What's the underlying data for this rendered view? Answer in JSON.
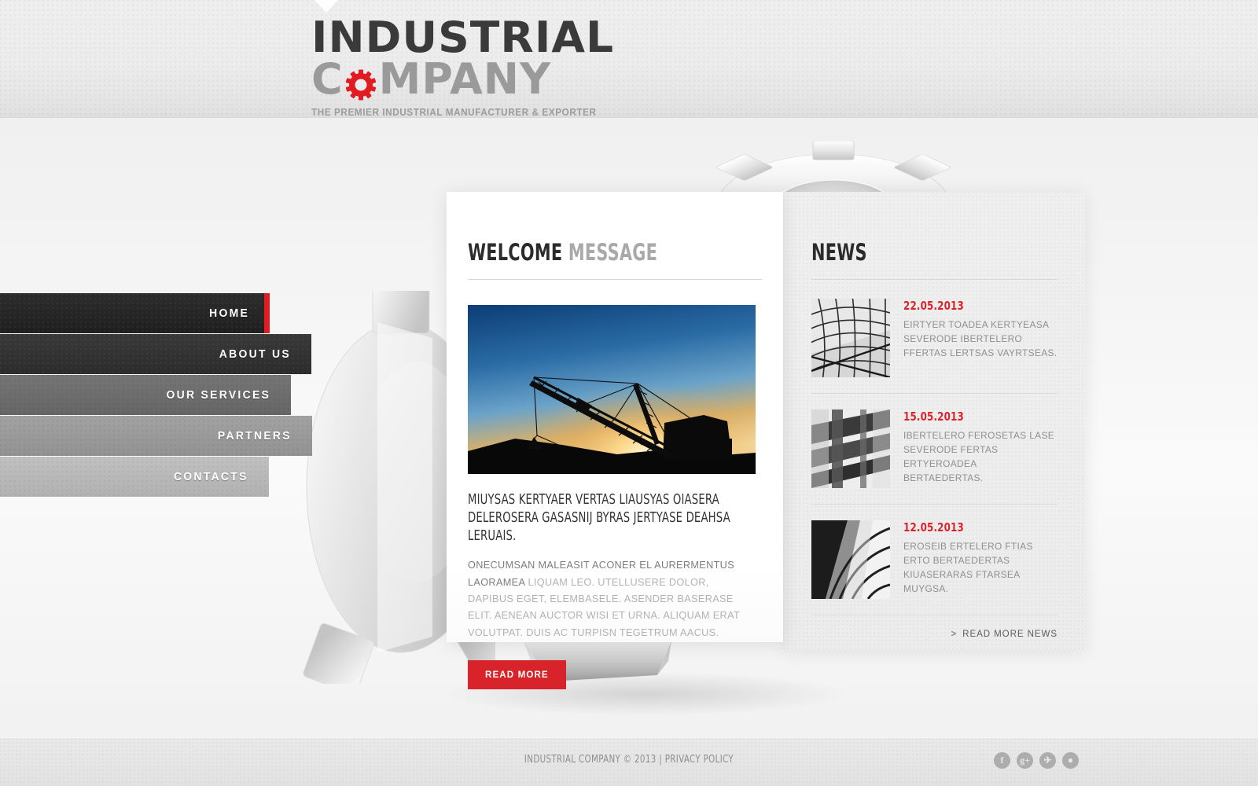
{
  "header": {
    "logo_line1": "INDUSTRIAL",
    "logo_line2_pre": "C",
    "logo_line2_post": "MPANY",
    "logo_gear_icon": "gear-icon",
    "tagline": "THE PREMIER INDUSTRIAL MANUFACTURER & EXPORTER"
  },
  "nav": {
    "items": [
      {
        "label": "HOME",
        "active": true
      },
      {
        "label": "ABOUT US",
        "active": false
      },
      {
        "label": "OUR SERVICES",
        "active": false
      },
      {
        "label": "PARTNERS",
        "active": false
      },
      {
        "label": "CONTACTS",
        "active": false
      }
    ]
  },
  "welcome": {
    "title_dark": "WELCOME",
    "title_light": "MESSAGE",
    "image_alt": "dragline-excavator-at-sunset",
    "lead": "MIUYSAS KERTYAER VERTAS LIAUSYAS OIASERA DELEROSERA GASASNIJ BYRAS JERTYASE DEAHSA LERUAIS.",
    "paragraph_first": "ONECUMSAN MALEASIT ACONER EL AURERMENTUS LAORAMEA",
    "paragraph_rest": " LIQUAM LEO. UTELLUSERE DOLOR, DAPIBUS EGET, ELEMBASELE. ASENDER BASERASE ELIT. AENEAN AUCTOR WISI ET URNA. ALIQUAM ERAT VOLUTPAT. DUIS AC TURPISN TEGETRUM AACUS.",
    "read_more_label": "READ MORE"
  },
  "news": {
    "title": "NEWS",
    "items": [
      {
        "date": "22.05.2013",
        "text": "EIRTYER TOADEA KERTYEASA SEVERODE IBERTELERO FFERTAS LERTSAS VAYRTSEAS.",
        "thumb_alt": "steel-dome-lattice-photo"
      },
      {
        "date": "15.05.2013",
        "text": "IBERTELERO FEROSETAS LASE SEVERODE FERTAS ERTYEROADEA BERTAEDERTAS.",
        "thumb_alt": "steel-beam-structure-photo"
      },
      {
        "date": "12.05.2013",
        "text": "EROSEIB ERTELERO FTIAS ERTO BERTAEDERTAS KIUASERARAS FTARSEA MUYGSA.",
        "thumb_alt": "curved-glass-roof-photo"
      }
    ],
    "more_label": "READ MORE NEWS",
    "more_chevron": ">"
  },
  "footer": {
    "copyright": "INDUSTRIAL COMPANY © 2013",
    "separator": "|",
    "privacy_label": "PRIVACY POLICY",
    "social": [
      {
        "name": "facebook-icon",
        "glyph": "f"
      },
      {
        "name": "google-plus-icon",
        "glyph": "g+"
      },
      {
        "name": "twitter-icon",
        "glyph": "✈"
      },
      {
        "name": "dribbble-icon",
        "glyph": "●"
      }
    ]
  },
  "colors": {
    "accent_red": "#d9232a",
    "nav_active": "#272727",
    "heading_dark": "#2b2b2b",
    "heading_light": "#a9a9a9",
    "body_text": "#b2b2b2"
  }
}
